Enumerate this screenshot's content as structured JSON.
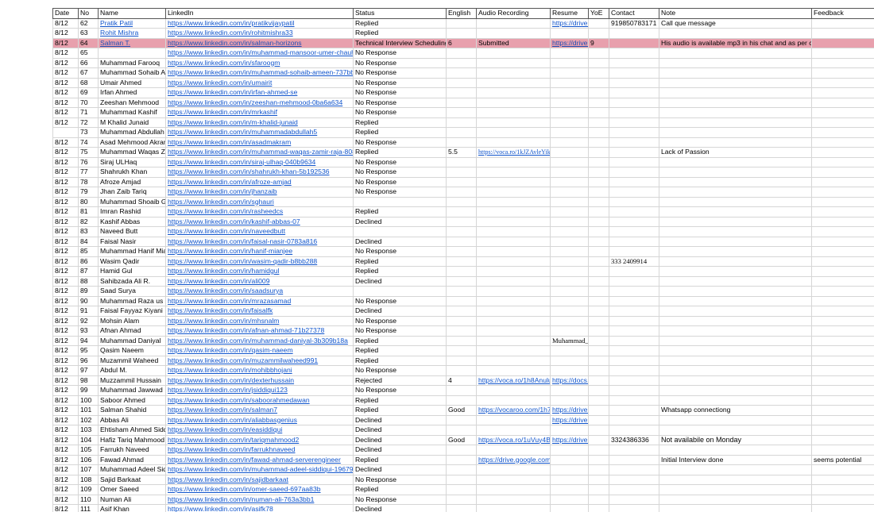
{
  "columns": [
    "Date",
    "No",
    "Name",
    "LinkedIn",
    "Status",
    "English",
    "Audio Recording",
    "Resume",
    "YoE",
    "Contact",
    "Note",
    "Feedback"
  ],
  "rows": [
    {
      "date": "8/12",
      "no": "62",
      "name": "Pratik Patil",
      "linkedin": "https://www.linkedin.com/in/pratikvijaypatil",
      "status": "Replied",
      "english": "",
      "audio": "",
      "resume": "https://drive.g",
      "yoe": "",
      "contact": "919850783171",
      "note": "Call que message",
      "feedback": "",
      "name_link": true
    },
    {
      "date": "8/12",
      "no": "63",
      "name": "Rohit Mishra",
      "linkedin": "https://www.linkedin.com/in/rohitmishra33",
      "status": "Replied",
      "english": "",
      "audio": "",
      "resume": "",
      "yoe": "",
      "contact": "",
      "note": "",
      "feedback": "",
      "name_link": true
    },
    {
      "date": "8/12",
      "no": "64",
      "name": "Salman T.",
      "linkedin": "https://www.linkedin.com/in/salman-horizons",
      "status": "Technical Interview Scheduling",
      "english": "6",
      "audio": "Submitted",
      "resume": "https://drive.g",
      "yoe": "9",
      "contact": "",
      "note": "His audio is available mp3 in his chat and as per ch",
      "feedback": "",
      "name_link": true,
      "highlight": true
    },
    {
      "date": "8/12",
      "no": "65",
      "name": "",
      "linkedin": "https://www.linkedin.com/in/muhammad-mansoor-umer-chauhc",
      "status": "No Response",
      "english": "",
      "audio": "",
      "resume": "",
      "yoe": "",
      "contact": "",
      "note": "",
      "feedback": ""
    },
    {
      "date": "8/12",
      "no": "66",
      "name": "Muhammad Farooq",
      "linkedin": "https://www.linkedin.com/in/sfaroogm",
      "status": "No Response",
      "english": "",
      "audio": "",
      "resume": "",
      "yoe": "",
      "contact": "",
      "note": "",
      "feedback": ""
    },
    {
      "date": "8/12",
      "no": "67",
      "name": "Muhammad Sohaib Ar",
      "linkedin": "https://www.linkedin.com/in/muhammad-sohaib-ameen-737bb3",
      "status": "No Response",
      "english": "",
      "audio": "",
      "resume": "",
      "yoe": "",
      "contact": "",
      "note": "",
      "feedback": ""
    },
    {
      "date": "8/12",
      "no": "68",
      "name": "Umair Ahmed",
      "linkedin": "https://www.linkedin.com/in/umairit",
      "status": "No Response",
      "english": "",
      "audio": "",
      "resume": "",
      "yoe": "",
      "contact": "",
      "note": "",
      "feedback": ""
    },
    {
      "date": "8/12",
      "no": "69",
      "name": "Irfan Ahmed",
      "linkedin": "https://www.linkedin.com/in/irfan-ahmed-se",
      "status": "No Response",
      "english": "",
      "audio": "",
      "resume": "",
      "yoe": "",
      "contact": "",
      "note": "",
      "feedback": ""
    },
    {
      "date": "8/12",
      "no": "70",
      "name": "Zeeshan Mehmood",
      "linkedin": "https://www.linkedin.com/in/zeeshan-mehmood-0ba6a634",
      "status": "No Response",
      "english": "",
      "audio": "",
      "resume": "",
      "yoe": "",
      "contact": "",
      "note": "",
      "feedback": ""
    },
    {
      "date": "8/12",
      "no": "71",
      "name": "Muhammad Kashif",
      "linkedin": "https://www.linkedin.com/in/mrkashif",
      "status": "No Response",
      "english": "",
      "audio": "",
      "resume": "",
      "yoe": "",
      "contact": "",
      "note": "",
      "feedback": ""
    },
    {
      "date": "8/12",
      "no": "72",
      "name": "M Khalid Junaid",
      "linkedin": "https://www.linkedin.com/in/m-khalid-junaid",
      "status": "Replied",
      "english": "",
      "audio": "",
      "resume": "",
      "yoe": "",
      "contact": "",
      "note": "",
      "feedback": ""
    },
    {
      "date": "",
      "no": "73",
      "name": "Muhammad Abdullah",
      "linkedin": "https://www.linkedin.com/in/muhammadabdullah5",
      "status": "Replied",
      "english": "",
      "audio": "",
      "resume": "",
      "yoe": "",
      "contact": "",
      "note": "",
      "feedback": ""
    },
    {
      "date": "8/12",
      "no": "74",
      "name": "Asad Mehmood Akram",
      "linkedin": "https://www.linkedin.com/in/asadmakram",
      "status": "No Response",
      "english": "",
      "audio": "",
      "resume": "",
      "yoe": "",
      "contact": "",
      "note": "",
      "feedback": ""
    },
    {
      "date": "8/12",
      "no": "75",
      "name": "Muhammad Waqas Za",
      "linkedin": "https://www.linkedin.com/in/muhammad-waqas-zamir-raja-808",
      "status": "Replied",
      "english": "5.5",
      "audio": "https://voca.ro/1kJZAvleYikn",
      "resume": "",
      "yoe": "",
      "contact": "",
      "note": "Lack of Passion",
      "feedback": "",
      "audio_serif": true
    },
    {
      "date": "8/12",
      "no": "76",
      "name": "Siraj ULHaq",
      "linkedin": "https://www.linkedin.com/in/siraj-ulhaq-040b9634",
      "status": "No Response",
      "english": "",
      "audio": "",
      "resume": "",
      "yoe": "",
      "contact": "",
      "note": "",
      "feedback": ""
    },
    {
      "date": "8/12",
      "no": "77",
      "name": "Shahrukh Khan",
      "linkedin": "https://www.linkedin.com/in/shahrukh-khan-5b192536",
      "status": "No Response",
      "english": "",
      "audio": "",
      "resume": "",
      "yoe": "",
      "contact": "",
      "note": "",
      "feedback": ""
    },
    {
      "date": "8/12",
      "no": "78",
      "name": "Afroze Amjad",
      "linkedin": "https://www.linkedin.com/in/afroze-amjad",
      "status": "No Response",
      "english": "",
      "audio": "",
      "resume": "",
      "yoe": "",
      "contact": "",
      "note": "",
      "feedback": ""
    },
    {
      "date": "8/12",
      "no": "79",
      "name": "Jhan Zaib Tariq",
      "linkedin": "https://www.linkedin.com/in/jhanzaib",
      "status": "No Response",
      "english": "",
      "audio": "",
      "resume": "",
      "yoe": "",
      "contact": "",
      "note": "",
      "feedback": ""
    },
    {
      "date": "8/12",
      "no": "80",
      "name": "Muhammad Shoaib Gl",
      "linkedin": "https://www.linkedin.com/in/sghauri",
      "status": "",
      "english": "",
      "audio": "",
      "resume": "",
      "yoe": "",
      "contact": "",
      "note": "",
      "feedback": ""
    },
    {
      "date": "8/12",
      "no": "81",
      "name": "Imran Rashid",
      "linkedin": "https://www.linkedin.com/in/rasheedcs",
      "status": "Replied",
      "english": "",
      "audio": "",
      "resume": "",
      "yoe": "",
      "contact": "",
      "note": "",
      "feedback": ""
    },
    {
      "date": "8/12",
      "no": "82",
      "name": "Kashif Abbas",
      "linkedin": "https://www.linkedin.com/in/kashif-abbas-07",
      "status": "Declined",
      "english": "",
      "audio": "",
      "resume": "",
      "yoe": "",
      "contact": "",
      "note": "",
      "feedback": ""
    },
    {
      "date": "8/12",
      "no": "83",
      "name": "Naveed Butt",
      "linkedin": "https://www.linkedin.com/in/naveedbutt",
      "status": "",
      "english": "",
      "audio": "",
      "resume": "",
      "yoe": "",
      "contact": "",
      "note": "",
      "feedback": ""
    },
    {
      "date": "8/12",
      "no": "84",
      "name": "Faisal Nasir",
      "linkedin": "https://www.linkedin.com/in/faisal-nasir-0783a816",
      "status": "Declined",
      "english": "",
      "audio": "",
      "resume": "",
      "yoe": "",
      "contact": "",
      "note": "",
      "feedback": ""
    },
    {
      "date": "8/12",
      "no": "85",
      "name": "Muhammad Hanif Mia",
      "linkedin": "https://www.linkedin.com/in/hanif-mianjee",
      "status": "No Response",
      "english": "",
      "audio": "",
      "resume": "",
      "yoe": "",
      "contact": "",
      "note": "",
      "feedback": ""
    },
    {
      "date": "8/12",
      "no": "86",
      "name": "Wasim Qadir",
      "linkedin": "https://www.linkedin.com/in/wasim-qadir-b8bb288",
      "status": "Replied",
      "english": "",
      "audio": "",
      "resume": "",
      "yoe": "",
      "contact": "333 2409914",
      "note": "",
      "feedback": "",
      "contact_serif": true
    },
    {
      "date": "8/12",
      "no": "87",
      "name": "Hamid Gul",
      "linkedin": "https://www.linkedin.com/in/hamidgul",
      "status": "Replied",
      "english": "",
      "audio": "",
      "resume": "",
      "yoe": "",
      "contact": "",
      "note": "",
      "feedback": ""
    },
    {
      "date": "8/12",
      "no": "88",
      "name": "Sahibzada Ali R.",
      "linkedin": "https://www.linkedin.com/in/ali009",
      "status": "Declined",
      "english": "",
      "audio": "",
      "resume": "",
      "yoe": "",
      "contact": "",
      "note": "",
      "feedback": ""
    },
    {
      "date": "8/12",
      "no": "89",
      "name": "Saad Surya",
      "linkedin": "https://www.linkedin.com/in/saadsurya",
      "status": "",
      "english": "",
      "audio": "",
      "resume": "",
      "yoe": "",
      "contact": "",
      "note": "",
      "feedback": ""
    },
    {
      "date": "8/12",
      "no": "90",
      "name": "Muhammad Raza us S",
      "linkedin": "https://www.linkedin.com/in/mrazasamad",
      "status": "No Response",
      "english": "",
      "audio": "",
      "resume": "",
      "yoe": "",
      "contact": "",
      "note": "",
      "feedback": ""
    },
    {
      "date": "8/12",
      "no": "91",
      "name": "Faisal Fayyaz Kiyani",
      "linkedin": "https://www.linkedin.com/in/faisalfk",
      "status": "Declined",
      "english": "",
      "audio": "",
      "resume": "",
      "yoe": "",
      "contact": "",
      "note": "",
      "feedback": ""
    },
    {
      "date": "8/12",
      "no": "92",
      "name": "Mohsin Alam",
      "linkedin": "https://www.linkedin.com/in/mhsnalm",
      "status": "No Response",
      "english": "",
      "audio": "",
      "resume": "",
      "yoe": "",
      "contact": "",
      "note": "",
      "feedback": ""
    },
    {
      "date": "8/12",
      "no": "93",
      "name": "Afnan Ahmad",
      "linkedin": "https://www.linkedin.com/in/afnan-ahmad-71b27378",
      "status": "No Response",
      "english": "",
      "audio": "",
      "resume": "",
      "yoe": "",
      "contact": "",
      "note": "",
      "feedback": ""
    },
    {
      "date": "8/12",
      "no": "94",
      "name": "Muhammad Daniyal",
      "linkedin": "https://www.linkedin.com/in/muhammad-daniyal-3b309b18a",
      "status": "Replied",
      "english": "",
      "audio": "",
      "resume": "Muhammad_",
      "yoe": "",
      "contact": "",
      "note": "",
      "feedback": "",
      "resume_plain": true
    },
    {
      "date": "8/12",
      "no": "95",
      "name": "Qasim Naeem",
      "linkedin": "https://www.linkedin.com/in/qasim-naeem",
      "status": "Replied",
      "english": "",
      "audio": "",
      "resume": "",
      "yoe": "",
      "contact": "",
      "note": "",
      "feedback": ""
    },
    {
      "date": "8/12",
      "no": "96",
      "name": "Muzammil Waheed",
      "linkedin": "https://www.linkedin.com/in/muzammilwaheed991",
      "status": "Replied",
      "english": "",
      "audio": "",
      "resume": "",
      "yoe": "",
      "contact": "",
      "note": "",
      "feedback": ""
    },
    {
      "date": "8/12",
      "no": "97",
      "name": "Abdul M.",
      "linkedin": "https://www.linkedin.com/in/mohibbhojani",
      "status": "No Response",
      "english": "",
      "audio": "",
      "resume": "",
      "yoe": "",
      "contact": "",
      "note": "",
      "feedback": ""
    },
    {
      "date": "8/12",
      "no": "98",
      "name": "Muzzammil Hussain",
      "linkedin": "https://www.linkedin.com/in/dexterhussain",
      "status": "Rejected",
      "english": "4",
      "audio": "https://voca.ro/1h8Anulu",
      "resume": "https://docs.g",
      "yoe": "",
      "contact": "",
      "note": "",
      "feedback": ""
    },
    {
      "date": "8/12",
      "no": "99",
      "name": "Muhammad Jawwad",
      "linkedin": "https://www.linkedin.com/in/jsiddiqui123",
      "status": "No Response",
      "english": "",
      "audio": "",
      "resume": "",
      "yoe": "",
      "contact": "",
      "note": "",
      "feedback": ""
    },
    {
      "date": "8/12",
      "no": "100",
      "name": "Saboor Ahmed",
      "linkedin": "https://www.linkedin.com/in/saboorahmedawan",
      "status": "Replied",
      "english": "",
      "audio": "",
      "resume": "",
      "yoe": "",
      "contact": "",
      "note": "",
      "feedback": ""
    },
    {
      "date": "8/12",
      "no": "101",
      "name": "Salman Shahid",
      "linkedin": "https://www.linkedin.com/in/salman7",
      "status": "Replied",
      "english": "Good",
      "audio": "https://vocaroo.com/1h7l",
      "resume": "https://drive.g",
      "yoe": "",
      "contact": "",
      "note": "Whatsapp connectiong",
      "feedback": ""
    },
    {
      "date": "8/12",
      "no": "102",
      "name": "Abbas Ali",
      "linkedin": "https://www.linkedin.com/in/aliabbasgenius",
      "status": "Declined",
      "english": "",
      "audio": "",
      "resume": "https://drive.g",
      "yoe": "",
      "contact": "",
      "note": "",
      "feedback": ""
    },
    {
      "date": "8/12",
      "no": "103",
      "name": "Ehtisham Ahmed Sidd",
      "linkedin": "https://www.linkedin.com/in/easiddiqui",
      "status": "Declined",
      "english": "",
      "audio": "",
      "resume": "",
      "yoe": "",
      "contact": "",
      "note": "",
      "feedback": ""
    },
    {
      "date": "8/12",
      "no": "104",
      "name": "Hafiz Tariq Mahmood",
      "linkedin": "https://www.linkedin.com/in/tariqmahmood2",
      "status": "Declined",
      "english": "Good",
      "audio": "https://voca.ro/1uVuy4B",
      "resume": "https://drive.g",
      "yoe": "",
      "contact": "3324386336",
      "note": "Not availabile on Monday",
      "feedback": "",
      "note_big": true
    },
    {
      "date": "8/12",
      "no": "105",
      "name": "Farrukh Naveed",
      "linkedin": "https://www.linkedin.com/in/farrukhnaveed",
      "status": "Declined",
      "english": "",
      "audio": "",
      "resume": "",
      "yoe": "",
      "contact": "",
      "note": "",
      "feedback": ""
    },
    {
      "date": "8/12",
      "no": "106",
      "name": "Fawad Ahmad",
      "linkedin": "https://www.linkedin.com/in/fawad-ahmad-serverengineer",
      "status": "Replied",
      "english": "",
      "audio": "https://drive.google.com/",
      "resume": "",
      "yoe": "",
      "contact": "",
      "note": "Initial Interview done",
      "feedback": "seems potential"
    },
    {
      "date": "8/12",
      "no": "107",
      "name": "Muhammad Adeel Sidd",
      "linkedin": "https://www.linkedin.com/in/muhammad-adeel-siddiqui-196799",
      "status": "Declined",
      "english": "",
      "audio": "",
      "resume": "",
      "yoe": "",
      "contact": "",
      "note": "",
      "feedback": ""
    },
    {
      "date": "8/12",
      "no": "108",
      "name": "Sajid Barkaat",
      "linkedin": "https://www.linkedin.com/in/sajidbarkaat",
      "status": "No Response",
      "english": "",
      "audio": "",
      "resume": "",
      "yoe": "",
      "contact": "",
      "note": "",
      "feedback": ""
    },
    {
      "date": "8/12",
      "no": "109",
      "name": "Omer Saeed",
      "linkedin": "https://www.linkedin.com/in/omer-saeed-697aa83b",
      "status": "Replied",
      "english": "",
      "audio": "",
      "resume": "",
      "yoe": "",
      "contact": "",
      "note": "",
      "feedback": ""
    },
    {
      "date": "8/12",
      "no": "110",
      "name": "Numan Ali",
      "linkedin": "https://www.linkedin.com/in/numan-ali-763a3bb1",
      "status": "No Response",
      "english": "",
      "audio": "",
      "resume": "",
      "yoe": "",
      "contact": "",
      "note": "",
      "feedback": ""
    },
    {
      "date": "8/12",
      "no": "111",
      "name": "Asif Khan",
      "linkedin": "https://www.linkedin.com/in/asifk78",
      "status": "Declined",
      "english": "",
      "audio": "",
      "resume": "",
      "yoe": "",
      "contact": "",
      "note": "",
      "feedback": ""
    }
  ]
}
